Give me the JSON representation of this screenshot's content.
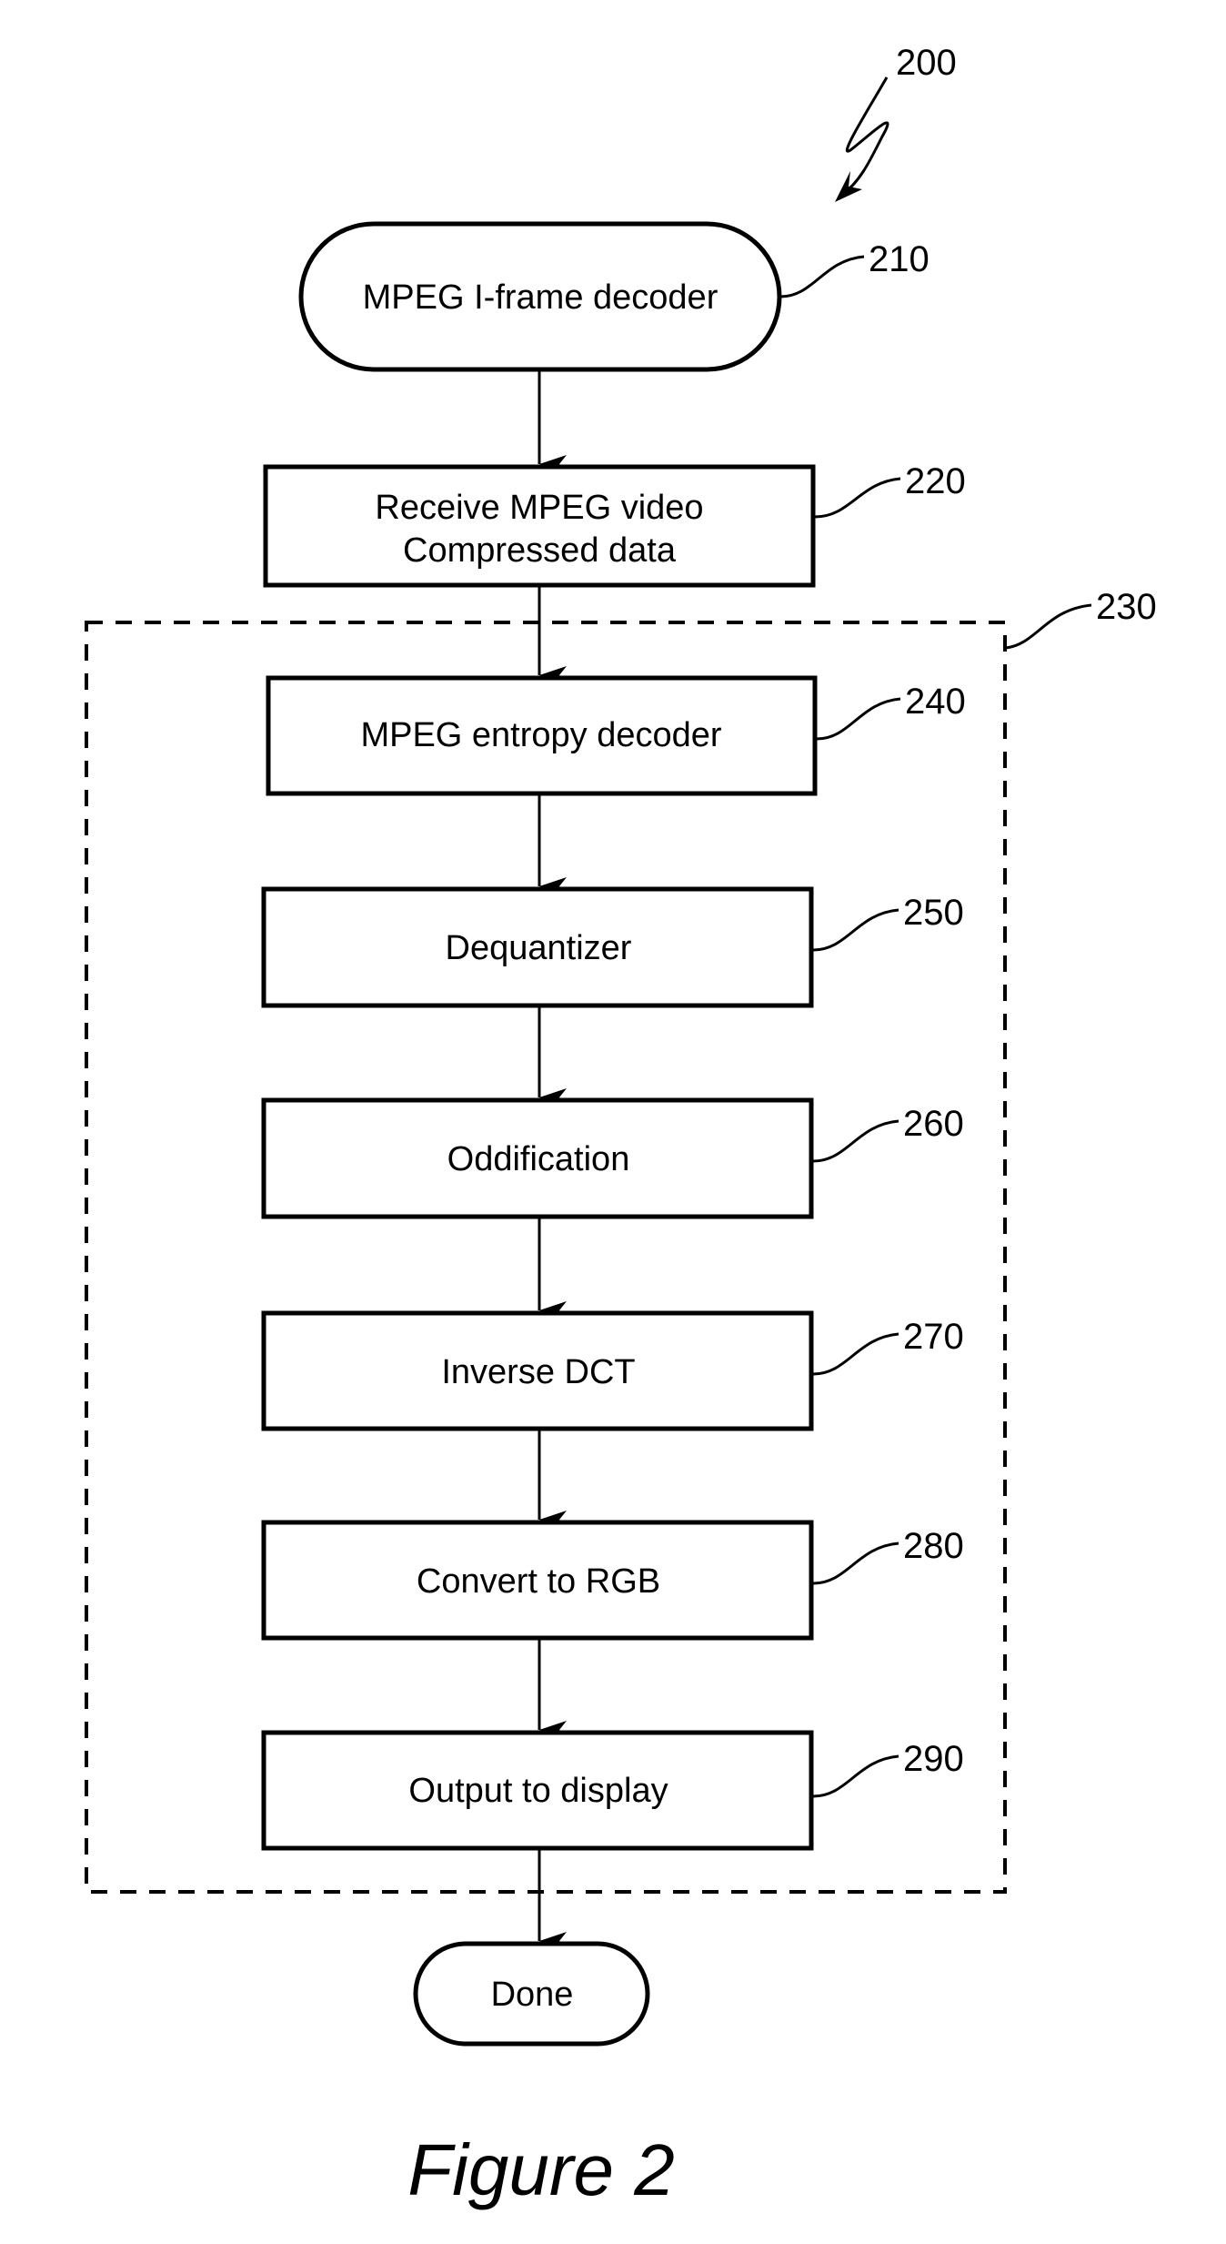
{
  "figure": {
    "caption": "Figure 2",
    "reference": "200",
    "group": {
      "reference": "230",
      "style": "dashed"
    },
    "nodes": [
      {
        "id": "210",
        "shape": "terminal",
        "lines": [
          "MPEG I-frame decoder"
        ]
      },
      {
        "id": "220",
        "shape": "process",
        "lines": [
          "Receive MPEG video",
          "Compressed data"
        ]
      },
      {
        "id": "240",
        "shape": "process",
        "lines": [
          "MPEG entropy decoder"
        ],
        "group": "230"
      },
      {
        "id": "250",
        "shape": "process",
        "lines": [
          "Dequantizer"
        ],
        "group": "230"
      },
      {
        "id": "260",
        "shape": "process",
        "lines": [
          "Oddification"
        ],
        "group": "230"
      },
      {
        "id": "270",
        "shape": "process",
        "lines": [
          "Inverse DCT"
        ],
        "group": "230"
      },
      {
        "id": "280",
        "shape": "process",
        "lines": [
          "Convert to RGB"
        ],
        "group": "230"
      },
      {
        "id": "290",
        "shape": "process",
        "lines": [
          "Output to display"
        ],
        "group": "230"
      },
      {
        "id": "done",
        "shape": "terminal",
        "lines": [
          "Done"
        ]
      }
    ],
    "edges": [
      [
        "210",
        "220"
      ],
      [
        "220",
        "240"
      ],
      [
        "240",
        "250"
      ],
      [
        "250",
        "260"
      ],
      [
        "260",
        "270"
      ],
      [
        "270",
        "280"
      ],
      [
        "280",
        "290"
      ],
      [
        "290",
        "done"
      ]
    ]
  }
}
